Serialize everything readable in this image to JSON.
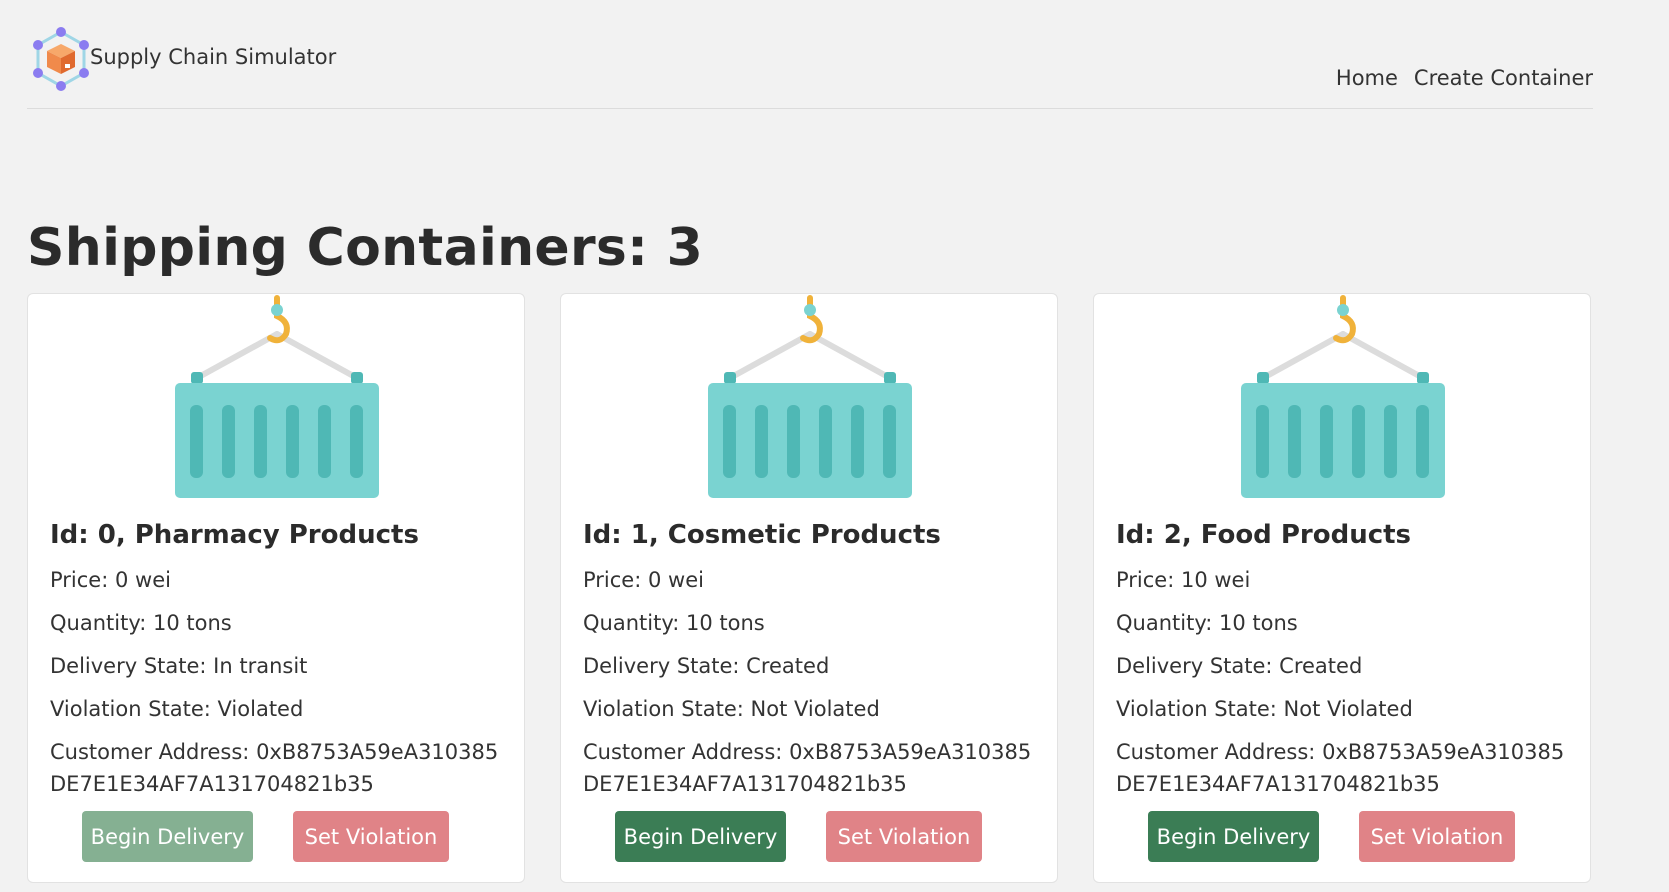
{
  "navbar": {
    "brand": "Supply Chain Simulator",
    "links": [
      "Home",
      "Create Container"
    ]
  },
  "page": {
    "title": "Shipping Containers: 3"
  },
  "containers": [
    {
      "title": "Id: 0, Pharmacy Products",
      "price": "Price: 0 wei",
      "quantity": "Quantity: 10 tons",
      "delivery_state": "Delivery State: In transit",
      "violation_state": "Violation State: Violated",
      "customer_address": "Customer Address: 0xB8753A59eA310385DE7E1E34AF7A131704821b35",
      "begin_label": "Begin Delivery",
      "violation_label": "Set Violation",
      "begin_disabled": true
    },
    {
      "title": "Id: 1, Cosmetic Products",
      "price": "Price: 0 wei",
      "quantity": "Quantity: 10 tons",
      "delivery_state": "Delivery State: Created",
      "violation_state": "Violation State: Not Violated",
      "customer_address": "Customer Address: 0xB8753A59eA310385DE7E1E34AF7A131704821b35",
      "begin_label": "Begin Delivery",
      "violation_label": "Set Violation",
      "begin_disabled": false
    },
    {
      "title": "Id: 2, Food Products",
      "price": "Price: 10 wei",
      "quantity": "Quantity: 10 tons",
      "delivery_state": "Delivery State: Created",
      "violation_state": "Violation State: Not Violated",
      "customer_address": "Customer Address: 0xB8753A59eA310385DE7E1E34AF7A131704821b35",
      "begin_label": "Begin Delivery",
      "violation_label": "Set Violation",
      "begin_disabled": false
    }
  ],
  "colors": {
    "background": "#f2f2f2",
    "begin_button": "#3b7d55",
    "begin_button_disabled": "#85b092",
    "violation_button": "#e08387",
    "container_body": "#7ad3d1",
    "container_ribs": "#4fb8b5",
    "hook": "#f0b23a"
  },
  "icons": {
    "logo": "package-network-icon",
    "card_image": "shipping-container-icon"
  }
}
